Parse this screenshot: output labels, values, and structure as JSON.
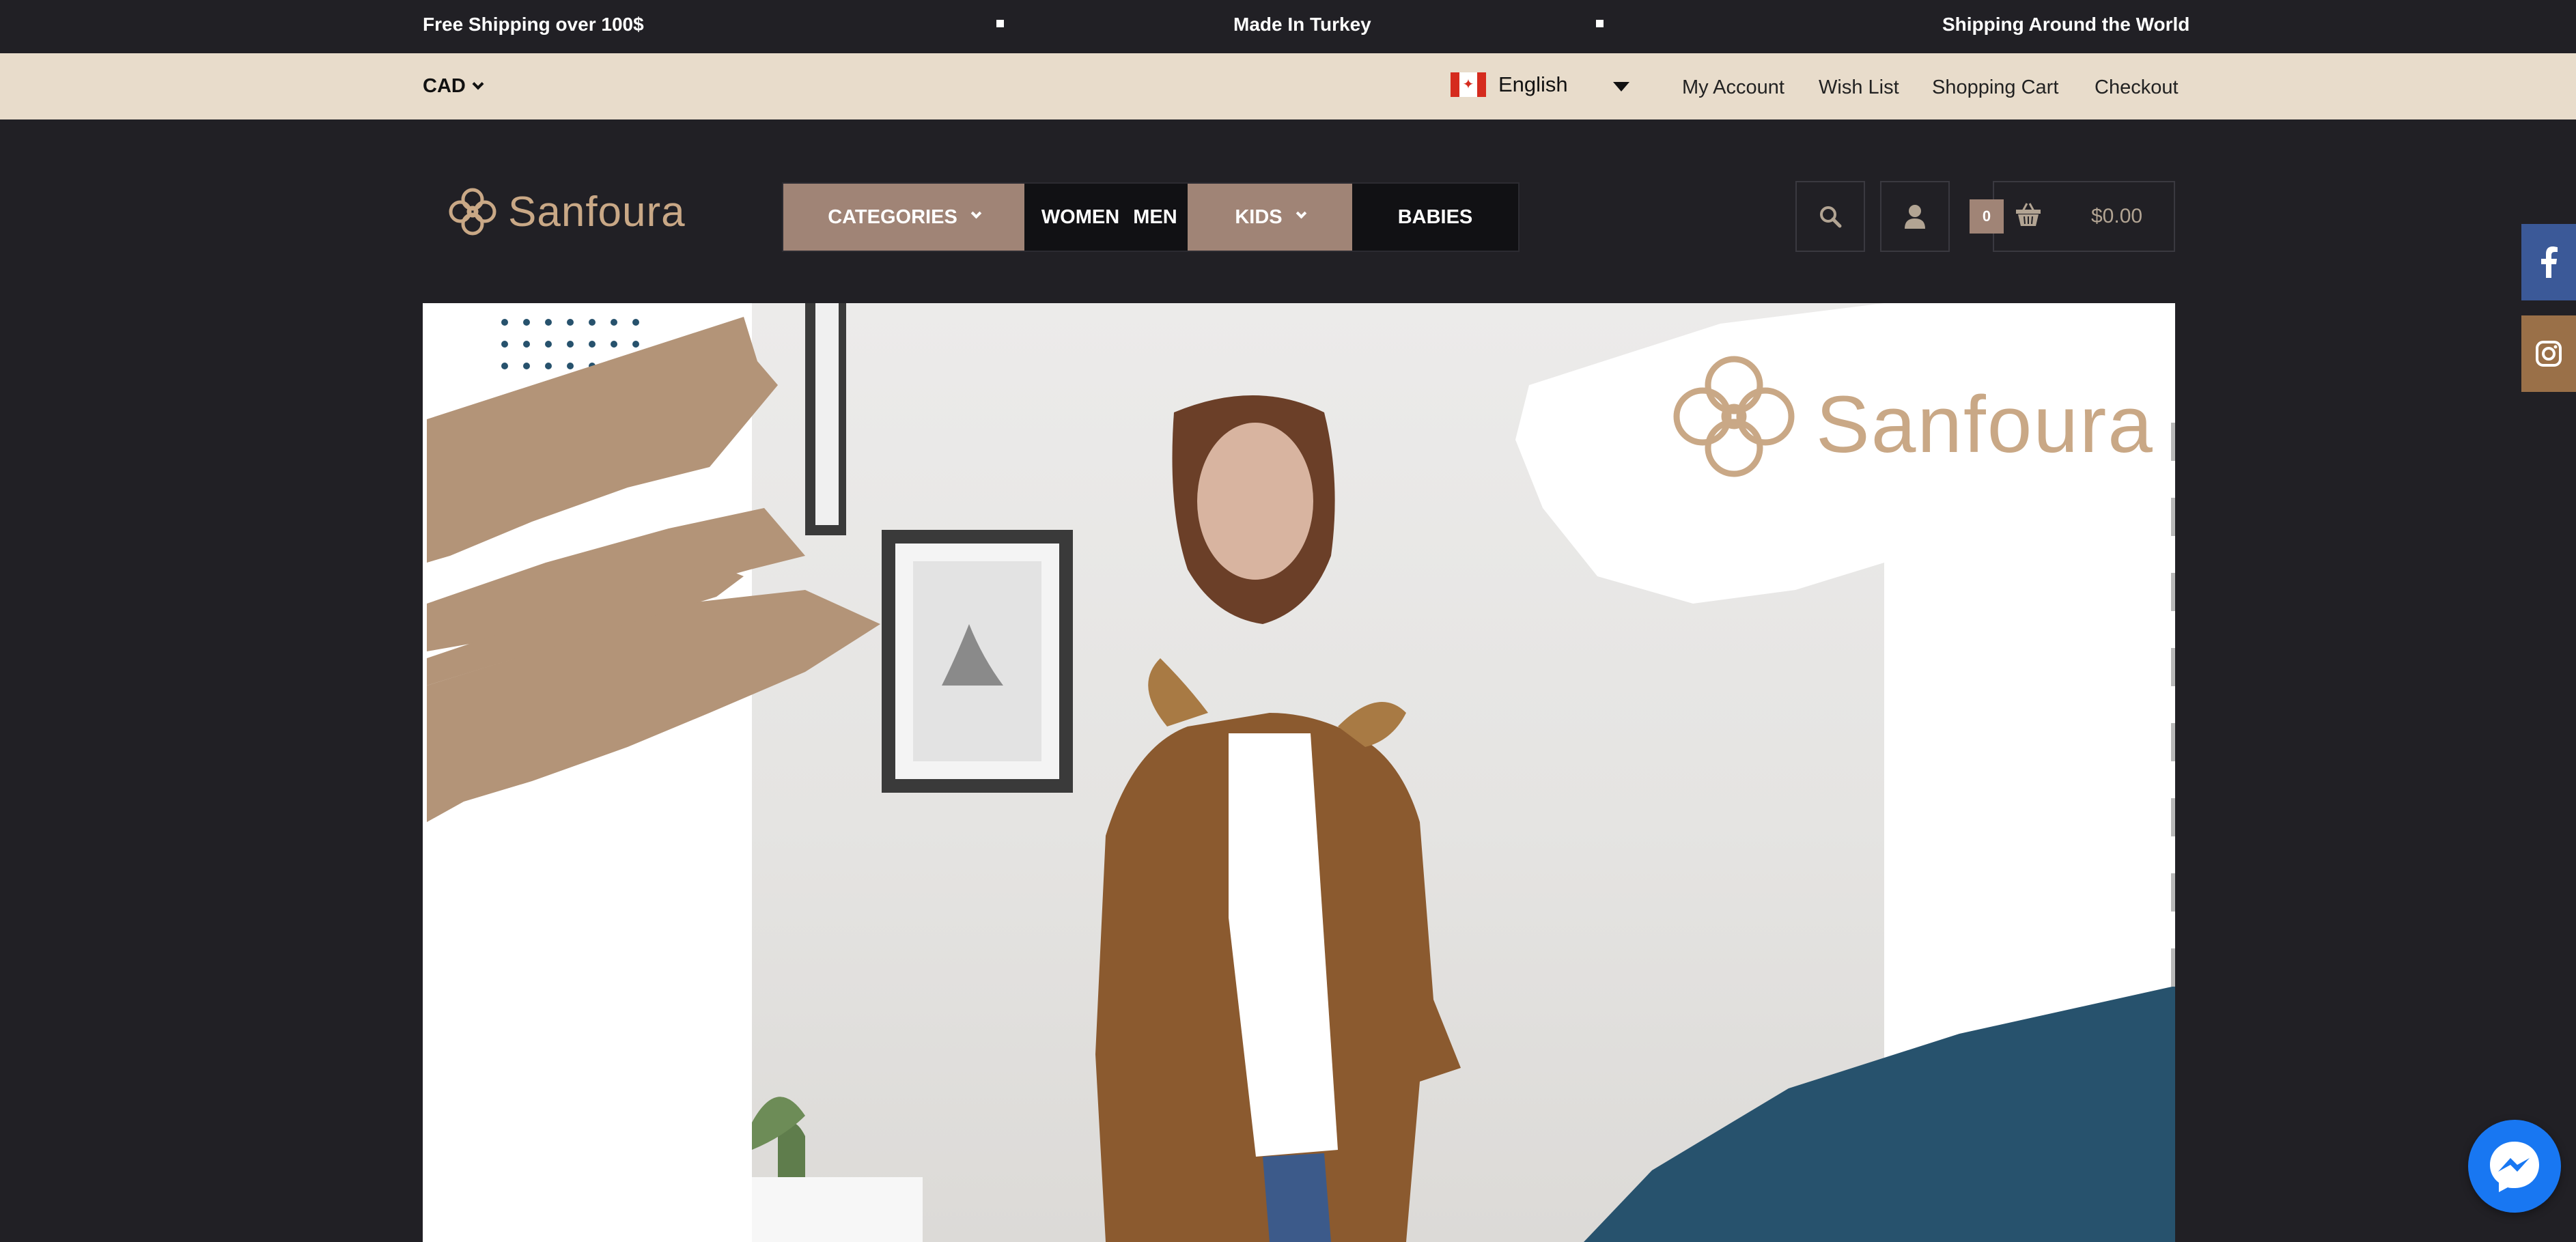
{
  "announcement_bar": {
    "messages": [
      "Free Shipping over 100$",
      "Made In Turkey",
      "Shipping Around the World"
    ]
  },
  "utility_bar": {
    "currency": "CAD",
    "language": "English",
    "links": [
      "My Account",
      "Wish List",
      "Shopping Cart",
      "Checkout"
    ]
  },
  "header": {
    "brand": "Sanfoura",
    "nav": [
      {
        "label": "CATEGORIES",
        "has_dropdown": true,
        "highlighted": true
      },
      {
        "label": "WOMEN",
        "has_dropdown": false,
        "highlighted": false
      },
      {
        "label": "MEN",
        "has_dropdown": false,
        "highlighted": false
      },
      {
        "label": "KIDS",
        "has_dropdown": true,
        "highlighted": true
      },
      {
        "label": "BABIES",
        "has_dropdown": false,
        "highlighted": false
      }
    ],
    "icons": [
      "search-icon",
      "user-icon",
      "basket-icon"
    ],
    "cart": {
      "count": "0",
      "total": "$0.00"
    }
  },
  "social": [
    {
      "name": "facebook",
      "color": "#3b5998"
    },
    {
      "name": "instagram",
      "color": "#9a7048"
    }
  ],
  "hero": {
    "brand_watermark": "Sanfoura",
    "colors": {
      "tan": "#b39478",
      "navy": "#27526d",
      "coat": "#8b5a2f",
      "hijab": "#6b3f28"
    }
  },
  "colors": {
    "dark_bg": "#212025",
    "util_bg": "#e8dccb",
    "accent": "#a08476",
    "logo_gold": "#c9a886",
    "messenger": "#1877f2"
  }
}
